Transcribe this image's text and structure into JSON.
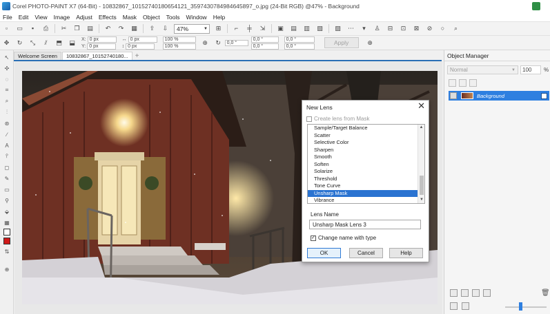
{
  "titlebar": {
    "title": "Corel PHOTO-PAINT X7 (64-Bit) - 10832867_10152740180654121_3597430784984645897_o.jpg (24-Bit RGB) @47% - Background"
  },
  "menu": [
    "File",
    "Edit",
    "View",
    "Image",
    "Adjust",
    "Effects",
    "Mask",
    "Object",
    "Tools",
    "Window",
    "Help"
  ],
  "toolbar": {
    "zoom": "47%"
  },
  "property_bar": {
    "x_label": "X:",
    "x_value": "0 px",
    "y_label": "Y:",
    "y_value": "0 px",
    "w_value": "0 px",
    "h_value": "0 px",
    "scale_w": "100 %",
    "scale_h": "100 %",
    "rotation": "0,0 °",
    "skew_h": "0,0 °",
    "skew_v": "0,0 °",
    "angle1": "0,0 °",
    "angle2": "0,0 °",
    "apply_label": "Apply"
  },
  "tabs": [
    {
      "label": "Welcome Screen",
      "active": false
    },
    {
      "label": "10832867_10152740180...",
      "active": true
    }
  ],
  "dialog": {
    "title": "New Lens",
    "close_glyph": "✕",
    "create_from_mask": "Create lens from Mask",
    "lens_list": [
      "Sample/Target Balance",
      "Scatter",
      "Selective Color",
      "Sharpen",
      "Smooth",
      "Soften",
      "Solarize",
      "Threshold",
      "Tone Curve",
      "Unsharp Mask",
      "Vibrance"
    ],
    "selected_index": 9,
    "lens_name_label": "Lens Name",
    "lens_name_value": "Unsharp Mask Lens 3",
    "change_name_label": "Change name with type",
    "change_name_checked": true,
    "ok_label": "OK",
    "cancel_label": "Cancel",
    "help_label": "Help"
  },
  "object_manager": {
    "title": "Object Manager",
    "blend_mode": "Normal",
    "opacity": "100",
    "opacity_unit": "%",
    "layer_name": "Background"
  },
  "colors": {
    "accent": "#2a73d1",
    "primary_swatch": "#d11a1a",
    "secondary_swatch": "#ffffff"
  }
}
